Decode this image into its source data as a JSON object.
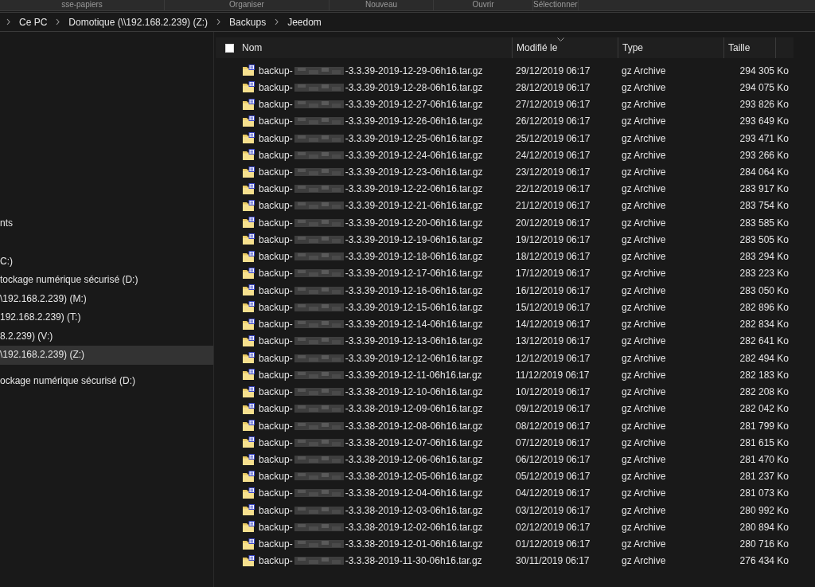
{
  "ribbon": {
    "groups": [
      "sse-papiers",
      "Organiser",
      "Nouveau",
      "Ouvrir",
      "Sélectionner"
    ]
  },
  "breadcrumb": [
    "Ce PC",
    "Domotique (\\\\192.168.2.239) (Z:)",
    "Backups",
    "Jeedom"
  ],
  "sidebar": {
    "groups": [
      [
        {
          "label": "nts",
          "selected": false
        }
      ],
      [
        {
          "label": "C:)",
          "selected": false
        },
        {
          "label": "tockage numérique sécurisé (D:)",
          "selected": false
        },
        {
          "label": "\\192.168.2.239) (M:)",
          "selected": false
        },
        {
          "label": "192.168.2.239) (T:)",
          "selected": false
        },
        {
          "label": "8.2.239) (V:)",
          "selected": false
        },
        {
          "label": "\\192.168.2.239) (Z:)",
          "selected": true
        }
      ],
      [
        {
          "label": "ockage numérique sécurisé (D:)",
          "selected": false
        }
      ]
    ]
  },
  "table": {
    "select_all": {
      "checked": false
    },
    "columns": [
      {
        "label": "Nom",
        "sorted": false
      },
      {
        "label": "Modifié le",
        "sorted": true
      },
      {
        "label": "Type",
        "sorted": false
      },
      {
        "label": "Taille",
        "sorted": false
      }
    ],
    "rows": [
      {
        "name_start": "backup-",
        "name_end": "-3.3.39-2019-12-29-06h16.tar.gz",
        "modified": "29/12/2019 06:17",
        "type": "gz Archive",
        "size": "294 305 Ko"
      },
      {
        "name_start": "backup-",
        "name_end": "-3.3.39-2019-12-28-06h16.tar.gz",
        "modified": "28/12/2019 06:17",
        "type": "gz Archive",
        "size": "294 075 Ko"
      },
      {
        "name_start": "backup-",
        "name_end": "-3.3.39-2019-12-27-06h16.tar.gz",
        "modified": "27/12/2019 06:17",
        "type": "gz Archive",
        "size": "293 826 Ko"
      },
      {
        "name_start": "backup-",
        "name_end": "-3.3.39-2019-12-26-06h16.tar.gz",
        "modified": "26/12/2019 06:17",
        "type": "gz Archive",
        "size": "293 649 Ko"
      },
      {
        "name_start": "backup-",
        "name_end": "-3.3.39-2019-12-25-06h16.tar.gz",
        "modified": "25/12/2019 06:17",
        "type": "gz Archive",
        "size": "293 471 Ko"
      },
      {
        "name_start": "backup-",
        "name_end": "-3.3.39-2019-12-24-06h16.tar.gz",
        "modified": "24/12/2019 06:17",
        "type": "gz Archive",
        "size": "293 266 Ko"
      },
      {
        "name_start": "backup-",
        "name_end": "-3.3.39-2019-12-23-06h16.tar.gz",
        "modified": "23/12/2019 06:17",
        "type": "gz Archive",
        "size": "284 064 Ko"
      },
      {
        "name_start": "backup-",
        "name_end": "-3.3.39-2019-12-22-06h16.tar.gz",
        "modified": "22/12/2019 06:17",
        "type": "gz Archive",
        "size": "283 917 Ko"
      },
      {
        "name_start": "backup-",
        "name_end": "-3.3.39-2019-12-21-06h16.tar.gz",
        "modified": "21/12/2019 06:17",
        "type": "gz Archive",
        "size": "283 754 Ko"
      },
      {
        "name_start": "backup-",
        "name_end": "-3.3.39-2019-12-20-06h16.tar.gz",
        "modified": "20/12/2019 06:17",
        "type": "gz Archive",
        "size": "283 585 Ko"
      },
      {
        "name_start": "backup-",
        "name_end": "-3.3.39-2019-12-19-06h16.tar.gz",
        "modified": "19/12/2019 06:17",
        "type": "gz Archive",
        "size": "283 505 Ko"
      },
      {
        "name_start": "backup-",
        "name_end": "-3.3.39-2019-12-18-06h16.tar.gz",
        "modified": "18/12/2019 06:17",
        "type": "gz Archive",
        "size": "283 294 Ko"
      },
      {
        "name_start": "backup-",
        "name_end": "-3.3.39-2019-12-17-06h16.tar.gz",
        "modified": "17/12/2019 06:17",
        "type": "gz Archive",
        "size": "283 223 Ko"
      },
      {
        "name_start": "backup-",
        "name_end": "-3.3.39-2019-12-16-06h16.tar.gz",
        "modified": "16/12/2019 06:17",
        "type": "gz Archive",
        "size": "283 050 Ko"
      },
      {
        "name_start": "backup-",
        "name_end": "-3.3.39-2019-12-15-06h16.tar.gz",
        "modified": "15/12/2019 06:17",
        "type": "gz Archive",
        "size": "282 896 Ko"
      },
      {
        "name_start": "backup-",
        "name_end": "-3.3.39-2019-12-14-06h16.tar.gz",
        "modified": "14/12/2019 06:17",
        "type": "gz Archive",
        "size": "282 834 Ko"
      },
      {
        "name_start": "backup-",
        "name_end": "-3.3.39-2019-12-13-06h16.tar.gz",
        "modified": "13/12/2019 06:17",
        "type": "gz Archive",
        "size": "282 641 Ko"
      },
      {
        "name_start": "backup-",
        "name_end": "-3.3.39-2019-12-12-06h16.tar.gz",
        "modified": "12/12/2019 06:17",
        "type": "gz Archive",
        "size": "282 494 Ko"
      },
      {
        "name_start": "backup-",
        "name_end": "-3.3.39-2019-12-11-06h16.tar.gz",
        "modified": "11/12/2019 06:17",
        "type": "gz Archive",
        "size": "282 183 Ko"
      },
      {
        "name_start": "backup-",
        "name_end": "-3.3.38-2019-12-10-06h16.tar.gz",
        "modified": "10/12/2019 06:17",
        "type": "gz Archive",
        "size": "282 208 Ko"
      },
      {
        "name_start": "backup-",
        "name_end": "-3.3.38-2019-12-09-06h16.tar.gz",
        "modified": "09/12/2019 06:17",
        "type": "gz Archive",
        "size": "282 042 Ko"
      },
      {
        "name_start": "backup-",
        "name_end": "-3.3.38-2019-12-08-06h16.tar.gz",
        "modified": "08/12/2019 06:17",
        "type": "gz Archive",
        "size": "281 799 Ko"
      },
      {
        "name_start": "backup-",
        "name_end": "-3.3.38-2019-12-07-06h16.tar.gz",
        "modified": "07/12/2019 06:17",
        "type": "gz Archive",
        "size": "281 615 Ko"
      },
      {
        "name_start": "backup-",
        "name_end": "-3.3.38-2019-12-06-06h16.tar.gz",
        "modified": "06/12/2019 06:17",
        "type": "gz Archive",
        "size": "281 470 Ko"
      },
      {
        "name_start": "backup-",
        "name_end": "-3.3.38-2019-12-05-06h16.tar.gz",
        "modified": "05/12/2019 06:17",
        "type": "gz Archive",
        "size": "281 237 Ko"
      },
      {
        "name_start": "backup-",
        "name_end": "-3.3.38-2019-12-04-06h16.tar.gz",
        "modified": "04/12/2019 06:17",
        "type": "gz Archive",
        "size": "281 073 Ko"
      },
      {
        "name_start": "backup-",
        "name_end": "-3.3.38-2019-12-03-06h16.tar.gz",
        "modified": "03/12/2019 06:17",
        "type": "gz Archive",
        "size": "280 992 Ko"
      },
      {
        "name_start": "backup-",
        "name_end": "-3.3.38-2019-12-02-06h16.tar.gz",
        "modified": "02/12/2019 06:17",
        "type": "gz Archive",
        "size": "280 894 Ko"
      },
      {
        "name_start": "backup-",
        "name_end": "-3.3.38-2019-12-01-06h16.tar.gz",
        "modified": "01/12/2019 06:17",
        "type": "gz Archive",
        "size": "280 716 Ko"
      },
      {
        "name_start": "backup-",
        "name_end": "-3.3.38-2019-11-30-06h16.tar.gz",
        "modified": "30/11/2019 06:17",
        "type": "gz Archive",
        "size": "276 434 Ko"
      }
    ]
  }
}
